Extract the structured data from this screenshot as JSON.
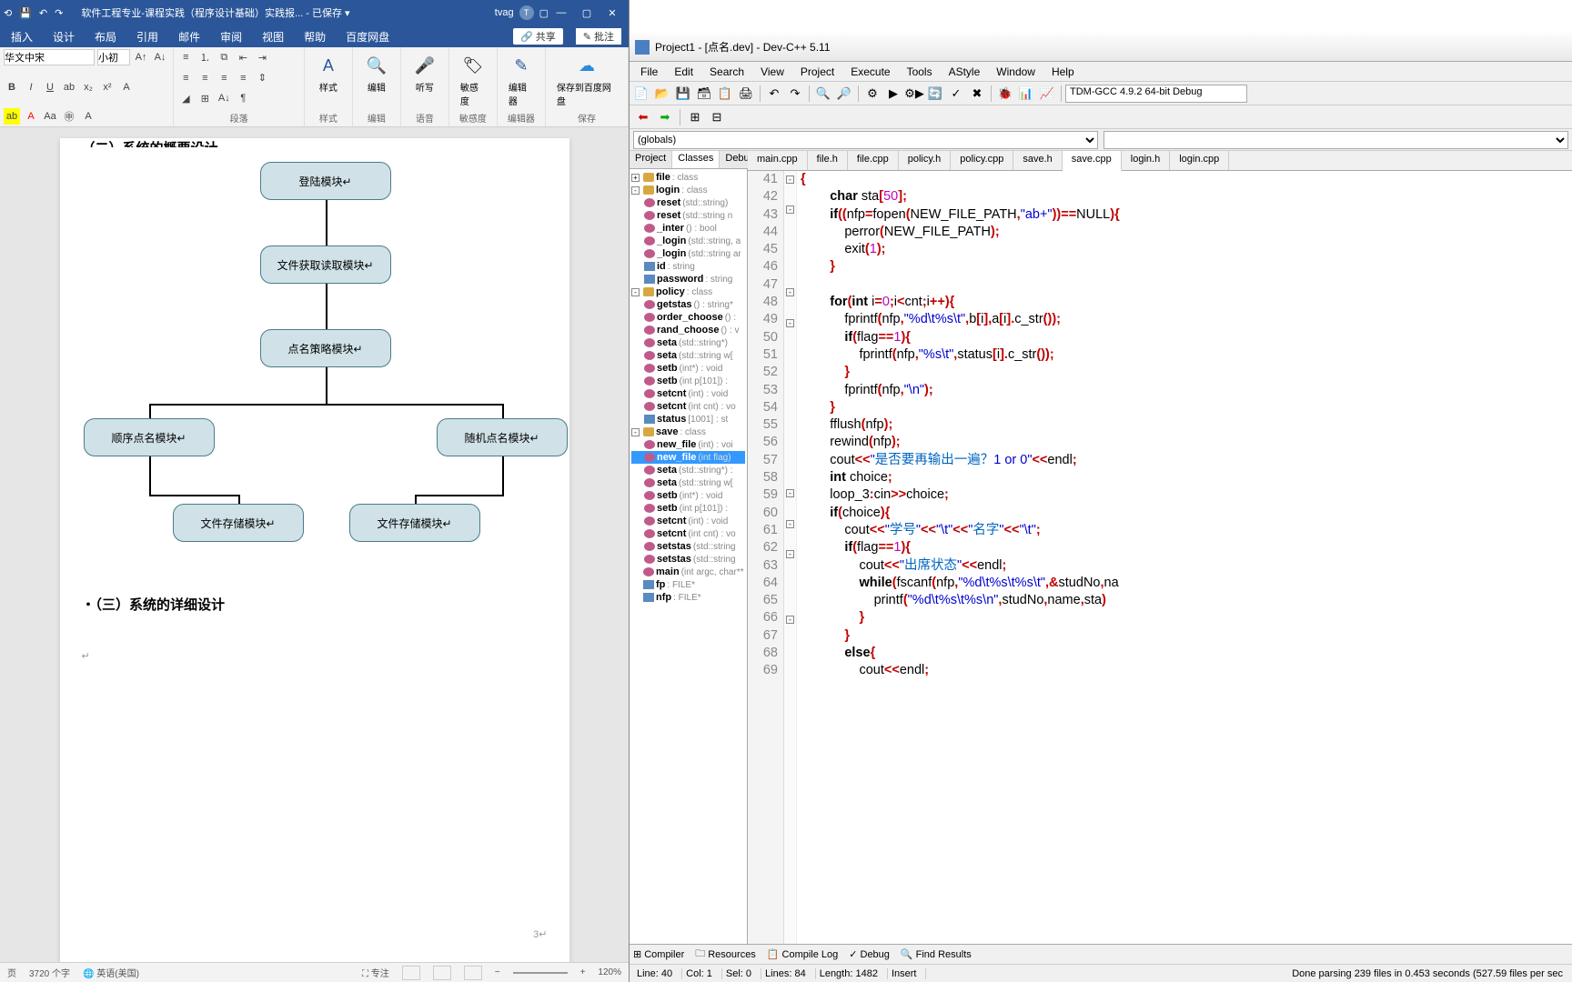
{
  "word": {
    "title": "软件工程专业-课程实践（程序设计基础）实践报... - 已保存 ▾",
    "user": "tvag",
    "avatar": "T",
    "tabs": [
      "插入",
      "设计",
      "布局",
      "引用",
      "邮件",
      "审阅",
      "视图",
      "帮助",
      "百度网盘"
    ],
    "share": "共享",
    "comment": "批注",
    "font_name": "华文中宋",
    "font_size": "小初",
    "groups": {
      "para": "段落",
      "style": "样式",
      "edit": "编辑",
      "voice": "语音",
      "sens": "敏感度",
      "editor": "编辑器",
      "save": "保存"
    },
    "style_btn": "样式",
    "edit_btn": "编辑",
    "voice_btn": "听写",
    "sens_btn": "敏感度",
    "editor_btn": "编辑器",
    "save_btn": "保存到百度网盘",
    "heading_cut": "（二）系统的概要设计",
    "diagram": {
      "n1": "登陆模块↵",
      "n2": "文件获取读取模块↵",
      "n3": "点名策略模块↵",
      "n4": "顺序点名模块↵",
      "n5": "随机点名模块↵",
      "n6": "文件存储模块↵",
      "n7": "文件存储模块↵"
    },
    "h3": "（三）系统的详细设计",
    "status": {
      "page": "页",
      "words": "3720 个字",
      "lang": "英语(美国)",
      "focus": "专注",
      "zoom": "120%"
    }
  },
  "dev": {
    "title": "Project1 - [点名.dev] - Dev-C++ 5.11",
    "menu": [
      "File",
      "Edit",
      "Search",
      "View",
      "Project",
      "Execute",
      "Tools",
      "AStyle",
      "Window",
      "Help"
    ],
    "compiler": "TDM-GCC 4.9.2 64-bit Debug",
    "globals": "(globals)",
    "left_tabs": [
      "Project",
      "Classes",
      "Debug"
    ],
    "tree": [
      {
        "l": 0,
        "exp": "+",
        "ico": "class",
        "name": "file",
        "sig": ": class"
      },
      {
        "l": 0,
        "exp": "-",
        "ico": "class",
        "name": "login",
        "sig": ": class"
      },
      {
        "l": 1,
        "ico": "func",
        "name": "reset",
        "sig": "(std::string)"
      },
      {
        "l": 1,
        "ico": "func",
        "name": "reset",
        "sig": "(std::string n"
      },
      {
        "l": 1,
        "ico": "func",
        "name": "_inter",
        "sig": "() : bool"
      },
      {
        "l": 1,
        "ico": "func",
        "name": "_login",
        "sig": "(std::string, a"
      },
      {
        "l": 1,
        "ico": "func",
        "name": "_login",
        "sig": "(std::string ar"
      },
      {
        "l": 1,
        "ico": "var",
        "name": "id",
        "sig": ": string"
      },
      {
        "l": 1,
        "ico": "var",
        "name": "password",
        "sig": ": string"
      },
      {
        "l": 0,
        "exp": "-",
        "ico": "class",
        "name": "policy",
        "sig": ": class"
      },
      {
        "l": 1,
        "ico": "func",
        "name": "getstas",
        "sig": "() : string*"
      },
      {
        "l": 1,
        "ico": "func",
        "name": "order_choose",
        "sig": "() :"
      },
      {
        "l": 1,
        "ico": "func",
        "name": "rand_choose",
        "sig": "() : v"
      },
      {
        "l": 1,
        "ico": "func",
        "name": "seta",
        "sig": "(std::string*)"
      },
      {
        "l": 1,
        "ico": "func",
        "name": "seta",
        "sig": "(std::string w["
      },
      {
        "l": 1,
        "ico": "func",
        "name": "setb",
        "sig": "(int*) : void"
      },
      {
        "l": 1,
        "ico": "func",
        "name": "setb",
        "sig": "(int p[101]) :"
      },
      {
        "l": 1,
        "ico": "func",
        "name": "setcnt",
        "sig": "(int) : void"
      },
      {
        "l": 1,
        "ico": "func",
        "name": "setcnt",
        "sig": "(int cnt) : vo"
      },
      {
        "l": 1,
        "ico": "var",
        "name": "status",
        "sig": "[1001] : st"
      },
      {
        "l": 0,
        "exp": "-",
        "ico": "class",
        "name": "save",
        "sig": ": class"
      },
      {
        "l": 1,
        "ico": "func",
        "name": "new_file",
        "sig": "(int) : voi"
      },
      {
        "l": 1,
        "ico": "func",
        "name": "new_file",
        "sig": "(int flag)",
        "sel": true
      },
      {
        "l": 1,
        "ico": "func",
        "name": "seta",
        "sig": "(std::string*) :"
      },
      {
        "l": 1,
        "ico": "func",
        "name": "seta",
        "sig": "(std::string w["
      },
      {
        "l": 1,
        "ico": "func",
        "name": "setb",
        "sig": "(int*) : void"
      },
      {
        "l": 1,
        "ico": "func",
        "name": "setb",
        "sig": "(int p[101]) :"
      },
      {
        "l": 1,
        "ico": "func",
        "name": "setcnt",
        "sig": "(int) : void"
      },
      {
        "l": 1,
        "ico": "func",
        "name": "setcnt",
        "sig": "(int cnt) : vo"
      },
      {
        "l": 1,
        "ico": "func",
        "name": "setstas",
        "sig": "(std::string"
      },
      {
        "l": 1,
        "ico": "func",
        "name": "setstas",
        "sig": "(std::string"
      },
      {
        "l": 0,
        "ico": "func",
        "name": "main",
        "sig": "(int argc, char**"
      },
      {
        "l": 0,
        "ico": "var",
        "name": "fp",
        "sig": ": FILE*"
      },
      {
        "l": 0,
        "ico": "var",
        "name": "nfp",
        "sig": ": FILE*"
      }
    ],
    "file_tabs": [
      "main.cpp",
      "file.h",
      "file.cpp",
      "policy.h",
      "policy.cpp",
      "save.h",
      "save.cpp",
      "login.h",
      "login.cpp"
    ],
    "active_tab": "save.cpp",
    "code_lines": [
      {
        "n": 41,
        "f": "-",
        "h": "<span class='op'>{</span>"
      },
      {
        "n": 42,
        "h": "        <span class='kw'>char</span> sta<span class='op'>[</span><span class='num'>50</span><span class='op'>];</span>"
      },
      {
        "n": 43,
        "f": "-",
        "h": "        <span class='kw'>if</span><span class='op'>((</span>nfp<span class='op'>=</span>fopen<span class='op'>(</span>NEW_FILE_PATH<span class='op'>,</span><span class='str'>\"ab+\"</span><span class='op'>))==</span>NULL<span class='op'>){</span>"
      },
      {
        "n": 44,
        "h": "            perror<span class='op'>(</span>NEW_FILE_PATH<span class='op'>);</span>"
      },
      {
        "n": 45,
        "h": "            exit<span class='op'>(</span><span class='num'>1</span><span class='op'>);</span>"
      },
      {
        "n": 46,
        "h": "        <span class='op'>}</span>"
      },
      {
        "n": 47,
        "h": ""
      },
      {
        "n": 48,
        "f": "-",
        "h": "        <span class='kw'>for</span><span class='op'>(</span><span class='kw'>int</span> i<span class='op'>=</span><span class='num'>0</span><span class='op'>;</span>i<span class='op'>&lt;</span>cnt<span class='op'>;</span>i<span class='op'>++){</span>"
      },
      {
        "n": 49,
        "h": "            fprintf<span class='op'>(</span>nfp<span class='op'>,</span><span class='str'>\"%d\\t%s\\t\"</span><span class='op'>,</span>b<span class='op'>[</span>i<span class='op'>],</span>a<span class='op'>[</span>i<span class='op'>].</span>c_str<span class='op'>());</span>"
      },
      {
        "n": 50,
        "f": "-",
        "h": "            <span class='kw'>if</span><span class='op'>(</span>flag<span class='op'>==</span><span class='num'>1</span><span class='op'>){</span>"
      },
      {
        "n": 51,
        "h": "                fprintf<span class='op'>(</span>nfp<span class='op'>,</span><span class='str'>\"%s\\t\"</span><span class='op'>,</span>status<span class='op'>[</span>i<span class='op'>].</span>c_str<span class='op'>());</span>"
      },
      {
        "n": 52,
        "h": "            <span class='op'>}</span>"
      },
      {
        "n": 53,
        "h": "            fprintf<span class='op'>(</span>nfp<span class='op'>,</span><span class='str'>\"\\n\"</span><span class='op'>);</span>"
      },
      {
        "n": 54,
        "h": "        <span class='op'>}</span>"
      },
      {
        "n": 55,
        "h": "        fflush<span class='op'>(</span>nfp<span class='op'>);</span>"
      },
      {
        "n": 56,
        "h": "        rewind<span class='op'>(</span>nfp<span class='op'>);</span>"
      },
      {
        "n": 57,
        "h": "        cout<span class='op'>&lt;&lt;</span><span class='str'>\"<span class='cn'>是否要再输出一遍？</span>1 or 0\"</span><span class='op'>&lt;&lt;</span>endl<span class='op'>;</span>"
      },
      {
        "n": 58,
        "h": "        <span class='kw'>int</span> choice<span class='op'>;</span>"
      },
      {
        "n": 59,
        "h": "        loop_3<span class='op'>:</span>cin<span class='op'>&gt;&gt;</span>choice<span class='op'>;</span>"
      },
      {
        "n": 60,
        "f": "-",
        "h": "        <span class='kw'>if</span><span class='op'>(</span>choice<span class='op'>){</span>"
      },
      {
        "n": 61,
        "h": "            cout<span class='op'>&lt;&lt;</span><span class='str'>\"<span class='cn'>学号</span>\"</span><span class='op'>&lt;&lt;</span><span class='str'>\"\\t\"</span><span class='op'>&lt;&lt;</span><span class='str'>\"<span class='cn'>名字</span>\"</span><span class='op'>&lt;&lt;</span><span class='str'>\"\\t\"</span><span class='op'>;</span>"
      },
      {
        "n": 62,
        "f": "-",
        "h": "            <span class='kw'>if</span><span class='op'>(</span>flag<span class='op'>==</span><span class='num'>1</span><span class='op'>){</span>"
      },
      {
        "n": 63,
        "h": "                cout<span class='op'>&lt;&lt;</span><span class='str'>\"<span class='cn'>出席状态</span>\"</span><span class='op'>&lt;&lt;</span>endl<span class='op'>;</span>"
      },
      {
        "n": 64,
        "f": "-",
        "h": "                <span class='kw'>while</span><span class='op'>(</span>fscanf<span class='op'>(</span>nfp<span class='op'>,</span><span class='str'>\"%d\\t%s\\t%s\\t\"</span><span class='op'>,&amp;</span>studNo<span class='op'>,</span>na"
      },
      {
        "n": 65,
        "h": "                    printf<span class='op'>(</span><span class='str'>\"%d\\t%s\\t%s\\n\"</span><span class='op'>,</span>studNo<span class='op'>,</span>name<span class='op'>,</span>sta<span class='op'>)</span>"
      },
      {
        "n": 66,
        "h": "                <span class='op'>}</span>"
      },
      {
        "n": 67,
        "h": "            <span class='op'>}</span>"
      },
      {
        "n": 68,
        "f": "-",
        "h": "            <span class='kw'>else</span><span class='op'>{</span>"
      },
      {
        "n": 69,
        "h": "                cout<span class='op'>&lt;&lt;</span>endl<span class='op'>;</span>"
      }
    ],
    "bottom_tabs": [
      "Compiler",
      "Resources",
      "Compile Log",
      "Debug",
      "Find Results"
    ],
    "status": {
      "line": "Line:   40",
      "col": "Col:   1",
      "sel": "Sel:   0",
      "lines": "Lines:   84",
      "length": "Length:  1482",
      "mode": "Insert",
      "msg": "Done parsing 239 files in 0.453 seconds (527.59 files per sec"
    }
  }
}
